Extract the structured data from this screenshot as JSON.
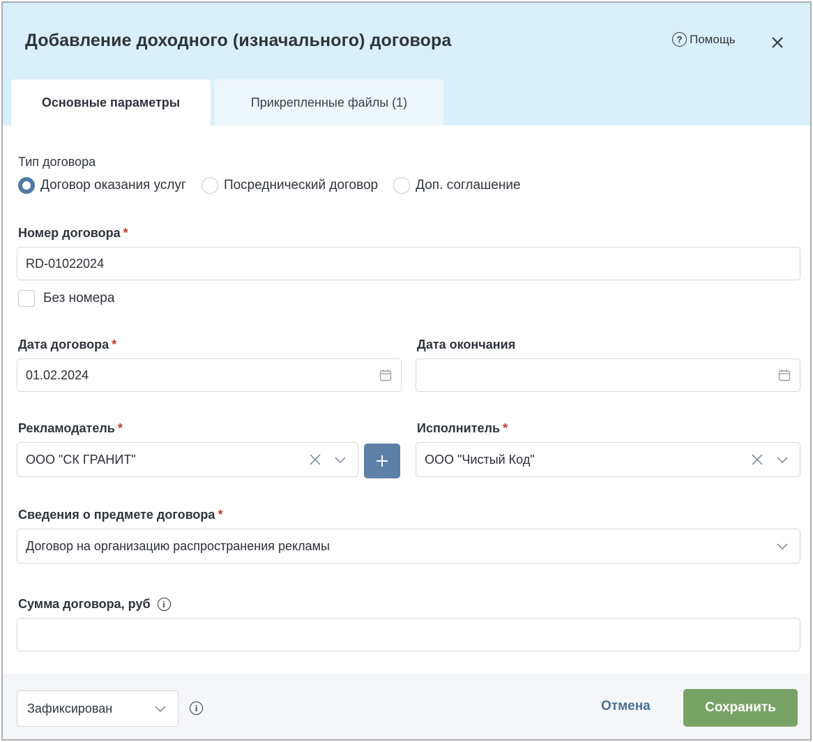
{
  "header": {
    "title": "Добавление доходного (изначального) договора",
    "help_label": "Помощь"
  },
  "tabs": [
    {
      "label": "Основные параметры",
      "active": true
    },
    {
      "label": "Прикрепленные файлы (1)",
      "active": false
    }
  ],
  "form": {
    "contract_type": {
      "label": "Тип договора",
      "options": [
        "Договор оказания услуг",
        "Посреднический договор",
        "Доп. соглашение"
      ],
      "selected": "Договор оказания услуг"
    },
    "contract_number": {
      "label": "Номер договора",
      "required_mark": "*",
      "value": "RD-01022024"
    },
    "no_number": {
      "label": "Без номера",
      "checked": false
    },
    "contract_date": {
      "label": "Дата договора",
      "required_mark": "*",
      "value": "01.02.2024"
    },
    "end_date": {
      "label": "Дата окончания",
      "value": ""
    },
    "advertiser": {
      "label": "Рекламодатель",
      "required_mark": "*",
      "value": "ООО \"СК ГРАНИТ\""
    },
    "contractor": {
      "label": "Исполнитель",
      "required_mark": "*",
      "value": "ООО \"Чистый Код\""
    },
    "subject": {
      "label": "Сведения о предмете договора",
      "required_mark": "*",
      "value": "Договор на организацию распространения рекламы"
    },
    "amount": {
      "label": "Сумма договора, руб",
      "value": ""
    }
  },
  "footer": {
    "status_value": "Зафиксирован",
    "cancel_label": "Отмена",
    "save_label": "Сохранить"
  },
  "colors": {
    "header_bg": "#d8f0fb",
    "radio_accent": "#4f78a8",
    "plus_button": "#5d80a6",
    "save_button": "#78a367",
    "link": "#4a6f96",
    "required": "#c0392b"
  }
}
